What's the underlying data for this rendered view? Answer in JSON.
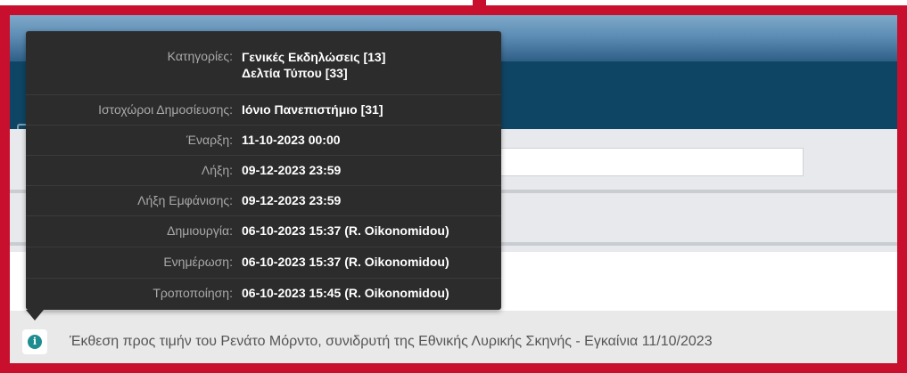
{
  "tooltip": {
    "rows": [
      {
        "label": "Κατηγορίες:",
        "value": "Γενικές Εκδηλώσεις [13]",
        "value2": "Δελτία Τύπου [33]"
      },
      {
        "label": "Ιστοχώροι Δημοσίευσης:",
        "value": "Ιόνιο Πανεπιστήμιο [31]"
      },
      {
        "label": "Έναρξη:",
        "value": "11-10-2023 00:00"
      },
      {
        "label": "Λήξη:",
        "value": "09-12-2023 23:59"
      },
      {
        "label": "Λήξη Εμφάνισης:",
        "value": "09-12-2023 23:59"
      },
      {
        "label": "Δημιουργία:",
        "value": "06-10-2023 15:37 (R. Oikonomidou)"
      },
      {
        "label": "Ενημέρωση:",
        "value": "06-10-2023 15:37 (R. Oikonomidou)"
      },
      {
        "label": "Τροποποίηση:",
        "value": "06-10-2023 15:45 (R. Oikonomidou)"
      }
    ]
  },
  "item": {
    "icon": "info-icon",
    "icon_glyph": "i",
    "title": "Έκθεση προς τιμήν του Ρενάτο Μόρντο, συνιδρυτή της Εθνικής Λυρικής Σκηνής - Εγκαίνια 11/10/2023"
  },
  "colors": {
    "highlight_frame": "#c8102e",
    "tooltip_bg": "#2c2c2c",
    "header_bar": "#0f4564",
    "info_icon": "#1f8c8f"
  }
}
